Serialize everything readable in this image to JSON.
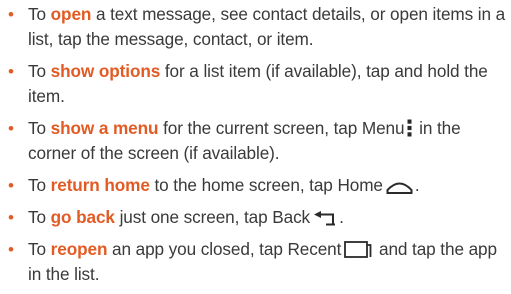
{
  "accent_color": "#e35b24",
  "text_color": "#3a3a3a",
  "items": [
    {
      "before": "To ",
      "keyword": "open",
      "after": " a text message, see contact details, or open items in a list, tap the message, contact, or item."
    },
    {
      "before": "To ",
      "keyword": "show options",
      "after": " for a list item (if available), tap and hold the item."
    },
    {
      "before": "To ",
      "keyword": "show a menu",
      "after": " for the current screen, tap Menu",
      "icon": "menu-icon",
      "after2": " in the corner of the screen (if available)."
    },
    {
      "before": "To ",
      "keyword": "return home",
      "after": " to the home screen, tap Home",
      "icon": "home-icon",
      "after2": "."
    },
    {
      "before": "To ",
      "keyword": "go back",
      "after": " just one screen, tap Back",
      "icon": "back-icon",
      "after2": "."
    },
    {
      "before": "To ",
      "keyword": "reopen",
      "after": " an app you closed, tap Recent",
      "icon": "recent-icon",
      "after2": " and tap the app in the list."
    }
  ]
}
